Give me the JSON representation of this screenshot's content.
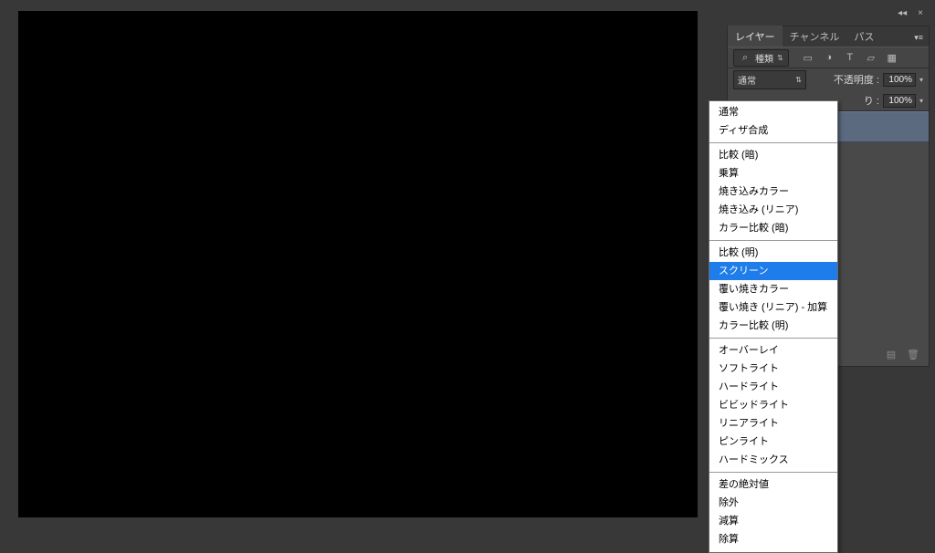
{
  "panel": {
    "tabs": {
      "active": "レイヤー",
      "t1": "チャンネル",
      "t2": "パス"
    },
    "filter_label": "種類",
    "blend_current": "通常",
    "opacity_label": "不透明度 :",
    "opacity_value": "100%",
    "fill_label_partial": "り :",
    "fill_value": "100%"
  },
  "dropdown": {
    "selected": "スクリーン",
    "groups": [
      [
        "通常",
        "ディザ合成"
      ],
      [
        "比較 (暗)",
        "乗算",
        "焼き込みカラー",
        "焼き込み (リニア)",
        "カラー比較 (暗)"
      ],
      [
        "比較 (明)",
        "スクリーン",
        "覆い焼きカラー",
        "覆い焼き (リニア) - 加算",
        "カラー比較 (明)"
      ],
      [
        "オーバーレイ",
        "ソフトライト",
        "ハードライト",
        "ビビッドライト",
        "リニアライト",
        "ピンライト",
        "ハードミックス"
      ],
      [
        "差の絶対値",
        "除外",
        "減算",
        "除算"
      ]
    ]
  },
  "icons": {
    "search": "⌕",
    "img": "▭",
    "fx": "◑",
    "text": "T",
    "shape": "▱",
    "smart": "▦",
    "caret": "÷",
    "link": "⌘",
    "style": "fx",
    "mask": "◌",
    "folder": "▣",
    "new": "▤",
    "trash": "🗑"
  }
}
